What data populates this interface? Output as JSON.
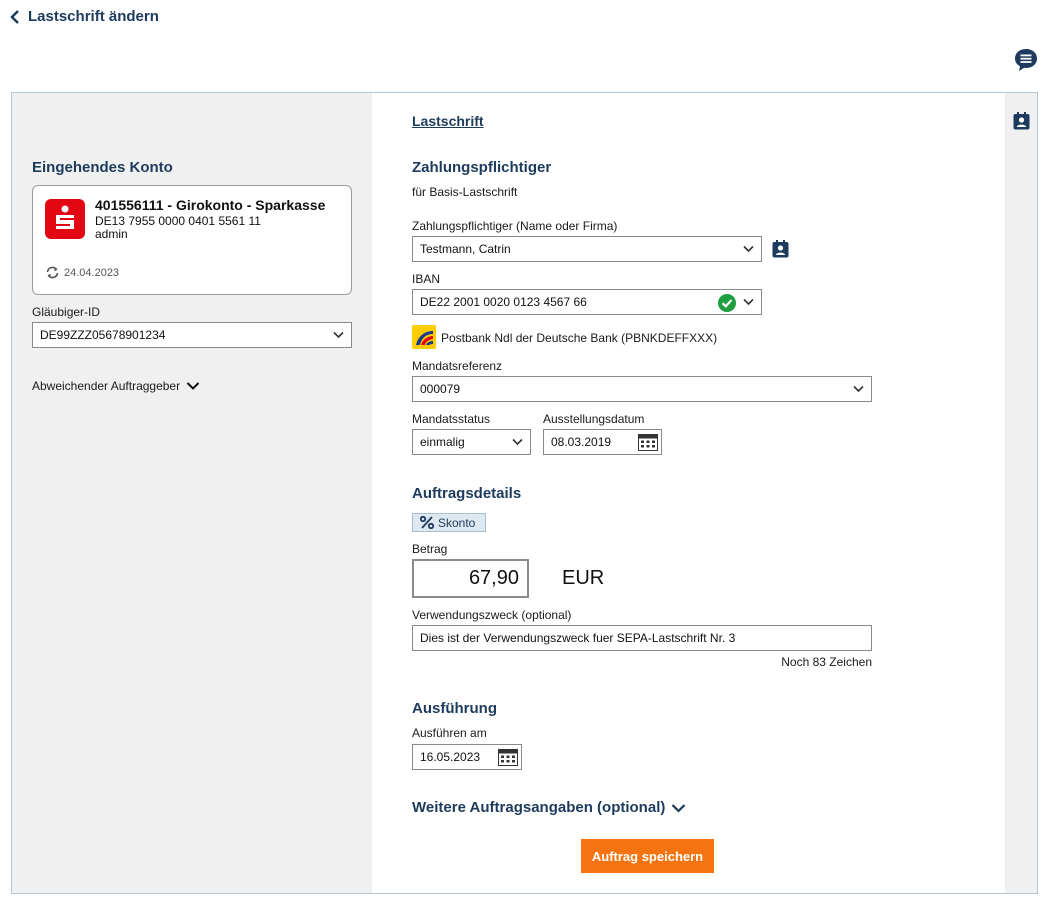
{
  "header": {
    "back_label": "Lastschrift ändern"
  },
  "left": {
    "incoming_title": "Eingehendes Konto",
    "account": {
      "title": "401556111 - Girokonto - Sparkasse",
      "iban": "DE13 7955 0000 0401 5561 11",
      "user": "admin",
      "sync_date": "24.04.2023"
    },
    "creditor_label": "Gläubiger-ID",
    "creditor_value": "DE99ZZZ05678901234",
    "alt_payer_label": "Abweichender Auftraggeber"
  },
  "main": {
    "tab_label": "Lastschrift",
    "payer_title": "Zahlungspflichtiger",
    "payer_subtitle": "für Basis-Lastschrift",
    "payer_name_label": "Zahlungspflichtiger (Name oder Firma)",
    "payer_name_value": "Testmann, Catrin",
    "iban_label": "IBAN",
    "iban_value": "DE22 2001 0020 0123 4567 66",
    "bank_name": "Postbank Ndl der Deutsche Bank",
    "bank_bic": "(PBNKDEFFXXX)",
    "mandate_ref_label": "Mandatsreferenz",
    "mandate_ref_value": "000079",
    "mandate_status_label": "Mandatsstatus",
    "mandate_status_value": "einmalig",
    "issue_date_label": "Ausstellungsdatum",
    "issue_date_value": "08.03.2019",
    "order_title": "Auftragsdetails",
    "discount_label": "Skonto",
    "amount_label": "Betrag",
    "amount_value": "67,90",
    "currency": "EUR",
    "purpose_label": "Verwendungszweck (optional)",
    "purpose_value": "Dies ist der Verwendungszweck fuer SEPA-Lastschrift Nr. 3",
    "chars_left": "Noch 83 Zeichen",
    "execution_title": "Ausführung",
    "execute_on_label": "Ausführen am",
    "execute_on_value": "16.05.2023",
    "more_details_label": "Weitere Auftragsangaben (optional)",
    "save_label": "Auftrag speichern"
  },
  "colors": {
    "brand": "#1d3b5c",
    "accent": "#f5740f",
    "sparkasse": "#e30613",
    "valid": "#1e9e3e",
    "postbank": "#ffcc00"
  }
}
